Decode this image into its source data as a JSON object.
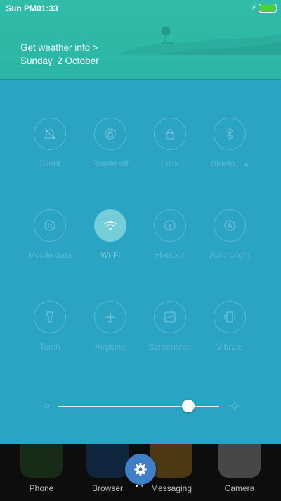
{
  "status_bar": {
    "time": "Sun PM01:33",
    "battery_level": 1.0,
    "charging_icon": "bolt-icon"
  },
  "weather": {
    "link_text": "Get weather info >",
    "date": "Sunday, 2 October"
  },
  "colors": {
    "panel": "#2ba3c3",
    "weather": "#31bca8",
    "accent_fab": "#3e7fc8",
    "battery": "#4cd137"
  },
  "toggles": [
    {
      "label": "Silent",
      "icon": "bell-off-icon",
      "active": false
    },
    {
      "label": "Rotate off",
      "icon": "rotate-lock-icon",
      "active": false
    },
    {
      "label": "Lock",
      "icon": "lock-icon",
      "active": false
    },
    {
      "label": "Blueto... ▴",
      "icon": "bluetooth-icon",
      "active": false
    },
    {
      "label": "Mobile data",
      "icon": "mobile-data-icon",
      "active": false
    },
    {
      "label": "Wi-Fi",
      "icon": "wifi-icon",
      "active": true
    },
    {
      "label": "Hotspot",
      "icon": "hotspot-icon",
      "active": false
    },
    {
      "label": "Auto bright",
      "icon": "auto-brightness-icon",
      "active": false
    },
    {
      "label": "Torch",
      "icon": "torch-icon",
      "active": false
    },
    {
      "label": "Airplane",
      "icon": "airplane-icon",
      "active": false
    },
    {
      "label": "Screenshot",
      "icon": "screenshot-icon",
      "active": false
    },
    {
      "label": "Vibrate",
      "icon": "vibrate-icon",
      "active": false
    }
  ],
  "brightness": {
    "level": 0.81
  },
  "dock": [
    {
      "label": "Phone",
      "icon": "phone-icon",
      "color": "#2e7d32"
    },
    {
      "label": "Browser",
      "icon": "browser-icon",
      "color": "#1565c0"
    },
    {
      "label": "Messaging",
      "icon": "messaging-icon",
      "color": "#f9a825"
    },
    {
      "label": "Camera",
      "icon": "camera-icon",
      "color": "#e0e0e0"
    }
  ],
  "settings_button": {
    "icon": "gear-icon"
  }
}
